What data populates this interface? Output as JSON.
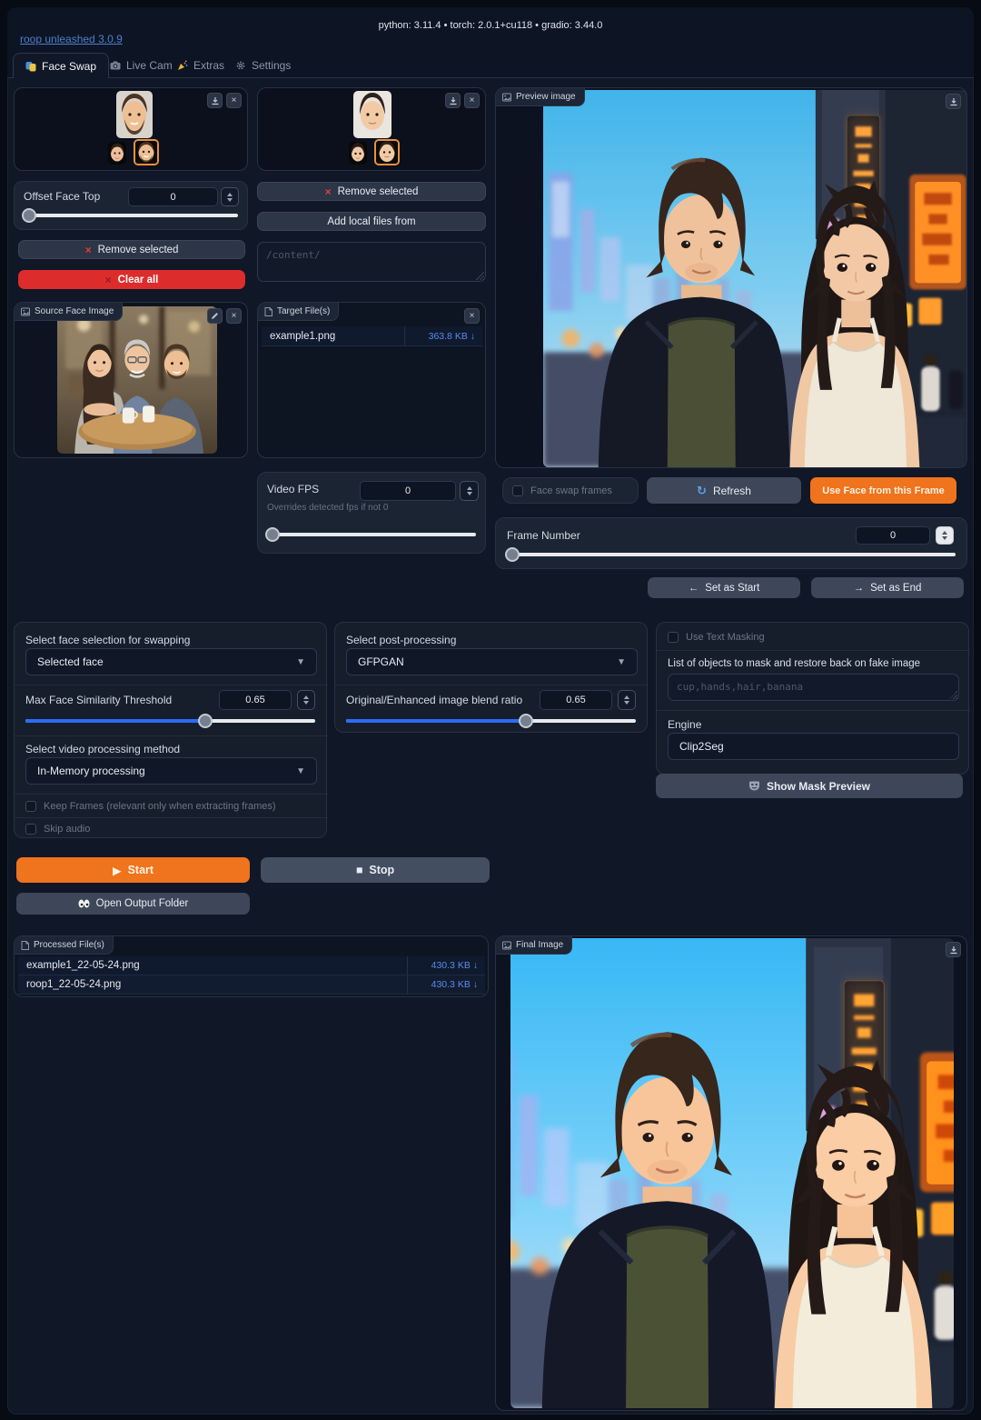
{
  "header": {
    "app_link": "roop unleashed 3.0.9",
    "env_info": "python: 3.11.4 • torch: 2.0.1+cu118 • gradio: 3.44.0"
  },
  "tabs": [
    {
      "label": "Face Swap"
    },
    {
      "label": "Live Cam"
    },
    {
      "label": "Extras"
    },
    {
      "label": "Settings"
    }
  ],
  "source_gallery": {
    "offset_label": "Offset Face Top",
    "offset_value": "0",
    "remove_btn": "Remove selected",
    "remove_icon": "×",
    "clear_btn": "Clear all",
    "clear_icon": "×"
  },
  "target_gallery": {
    "remove_btn": "Remove selected",
    "remove_icon": "×",
    "add_btn": "Add local files from",
    "path_placeholder": "/content/"
  },
  "source_image": {
    "chip": "Source Face Image"
  },
  "target_files": {
    "chip": "Target File(s)",
    "rows": [
      {
        "name": "example1.png",
        "size": "363.8 KB ↓"
      }
    ]
  },
  "video_fps": {
    "label": "Video FPS",
    "info": "Overrides detected fps if not 0",
    "value": "0"
  },
  "preview": {
    "chip": "Preview image",
    "frames_checkbox": "Face swap frames",
    "refresh_btn": "Refresh",
    "refresh_icon": "↻",
    "use_face_btn": "Use Face from this Frame",
    "frame_label": "Frame Number",
    "frame_value": "0",
    "set_start": "Set as Start",
    "set_start_icon": "←",
    "set_end": "Set as End",
    "set_end_icon": "→"
  },
  "swap_options": {
    "face_selection_label": "Select face selection for swapping",
    "face_selection_value": "Selected face",
    "similarity_label": "Max Face Similarity Threshold",
    "similarity_value": "0.65",
    "method_label": "Select video processing method",
    "method_value": "In-Memory processing",
    "keep_frames": "Keep Frames (relevant only when extracting frames)",
    "skip_audio": "Skip audio"
  },
  "post_options": {
    "label": "Select post-processing",
    "value": "GFPGAN",
    "blend_label": "Original/Enhanced image blend ratio",
    "blend_value": "0.65"
  },
  "masking": {
    "checkbox": "Use Text Masking",
    "objects_label": "List of objects to mask and restore back on fake image",
    "objects_placeholder": "cup,hands,hair,banana",
    "engine_label": "Engine",
    "engine_value": "Clip2Seg",
    "show_mask_btn": "Show Mask Preview"
  },
  "actions": {
    "start": "Start",
    "start_icon": "▶",
    "stop": "Stop",
    "stop_icon": "■",
    "open_output": "Open Output Folder"
  },
  "processed_files": {
    "chip": "Processed File(s)",
    "rows": [
      {
        "name": "example1_22-05-24.png",
        "size": "430.3 KB ↓"
      },
      {
        "name": "roop1_22-05-24.png",
        "size": "430.3 KB ↓"
      }
    ]
  },
  "final_image": {
    "chip": "Final Image"
  },
  "colors": {
    "accent_orange": "#f0731d",
    "danger_red": "#dc2c2c",
    "link_blue": "#5c8bea",
    "slider_blue": "#2a6df5",
    "selection_border": "#e8913f"
  }
}
